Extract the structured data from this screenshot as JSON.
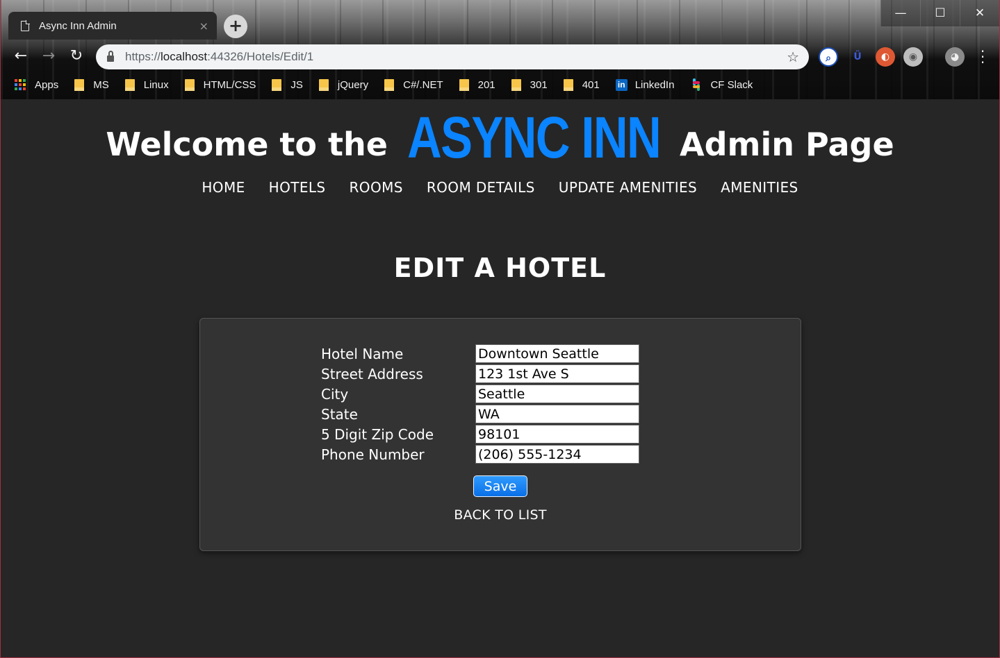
{
  "browser": {
    "tab_title": "Async Inn Admin",
    "tab_close": "×",
    "new_tab": "+",
    "url_scheme": "https://",
    "url_host": "localhost",
    "url_path": ":44326/Hotels/Edit/1",
    "window_controls": [
      "—",
      "☐",
      "✕"
    ],
    "bookmarks": [
      {
        "label": "Apps",
        "icon": "apps-icon"
      },
      {
        "label": "MS",
        "icon": "folder-icon"
      },
      {
        "label": "Linux",
        "icon": "folder-icon"
      },
      {
        "label": "HTML/CSS",
        "icon": "folder-icon"
      },
      {
        "label": "JS",
        "icon": "folder-icon"
      },
      {
        "label": "jQuery",
        "icon": "folder-icon"
      },
      {
        "label": "C#/.NET",
        "icon": "folder-icon"
      },
      {
        "label": "201",
        "icon": "folder-icon"
      },
      {
        "label": "301",
        "icon": "folder-icon"
      },
      {
        "label": "401",
        "icon": "folder-icon"
      },
      {
        "label": "LinkedIn",
        "icon": "linkedin-icon"
      },
      {
        "label": "CF Slack",
        "icon": "slack-icon"
      }
    ]
  },
  "header": {
    "welcome_prefix": "Welcome to the",
    "brand": "ASYNC INN",
    "welcome_suffix": "Admin Page",
    "brand_color": "#0a84ff"
  },
  "nav": {
    "items": [
      "HOME",
      "HOTELS",
      "ROOMS",
      "ROOM DETAILS",
      "UPDATE AMENITIES",
      "AMENITIES"
    ]
  },
  "page": {
    "heading": "EDIT A HOTEL"
  },
  "form": {
    "fields": [
      {
        "label": "Hotel Name",
        "value": "Downtown Seattle"
      },
      {
        "label": "Street Address",
        "value": "123 1st Ave S"
      },
      {
        "label": "City",
        "value": "Seattle"
      },
      {
        "label": "State",
        "value": "WA"
      },
      {
        "label": "5 Digit Zip Code",
        "value": "98101"
      },
      {
        "label": "Phone Number",
        "value": "(206) 555-1234"
      }
    ],
    "save_label": "Save",
    "back_label": "BACK TO LIST",
    "accent_color": "#0a6fe6"
  }
}
